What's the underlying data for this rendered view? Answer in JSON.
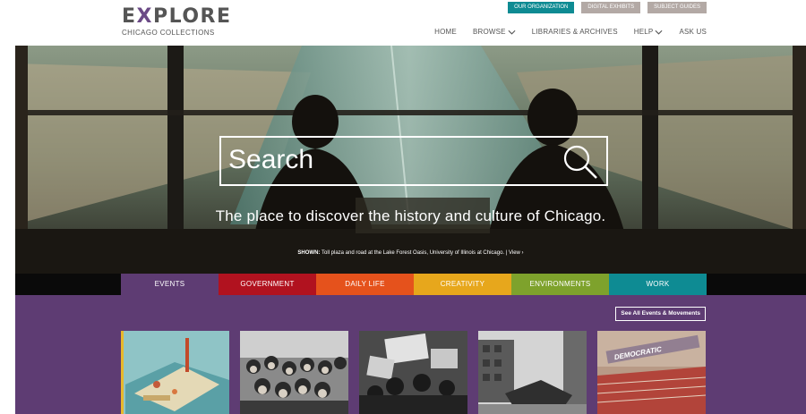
{
  "header": {
    "logo_title_pre": "E",
    "logo_title_x": "X",
    "logo_title_post": "PLORE",
    "logo_subtitle": "CHICAGO COLLECTIONS",
    "top_buttons": [
      "OUR ORGANIZATION",
      "DIGITAL EXHIBITS",
      "SUBJECT GUIDES"
    ],
    "nav": [
      "HOME",
      "BROWSE",
      "LIBRARIES & ARCHIVES",
      "HELP",
      "ASK US"
    ]
  },
  "hero": {
    "search_placeholder": "Search",
    "tagline": "The place to discover the history and culture of Chicago.",
    "shown_label": "SHOWN:",
    "shown_caption": " Toll plaza and road at the Lake Forest Oasis, University of Illinois at Chicago.  |  ",
    "shown_view": "View"
  },
  "tabs": [
    {
      "label": "EVENTS",
      "color": "#5e3c73"
    },
    {
      "label": "GOVERNMENT",
      "color": "#b1121f"
    },
    {
      "label": "DAILY LIFE",
      "color": "#e5521c"
    },
    {
      "label": "CREATIVITY",
      "color": "#e7a71c"
    },
    {
      "label": "ENVIRONMENTS",
      "color": "#7ea22c"
    },
    {
      "label": "WORK",
      "color": "#0e8b93"
    }
  ],
  "section": {
    "see_all": "See All Events & Movements",
    "thumbnails": [
      "world-fair-aerial-photo",
      "crowd-of-children-photo",
      "labor-protest-photo",
      "building-wreck-photo",
      "democratic-convention-photo"
    ]
  },
  "colors": {
    "accent_teal": "#0e8b93",
    "button_grey": "#b3a9a5",
    "section_purple": "#5e3c73"
  }
}
